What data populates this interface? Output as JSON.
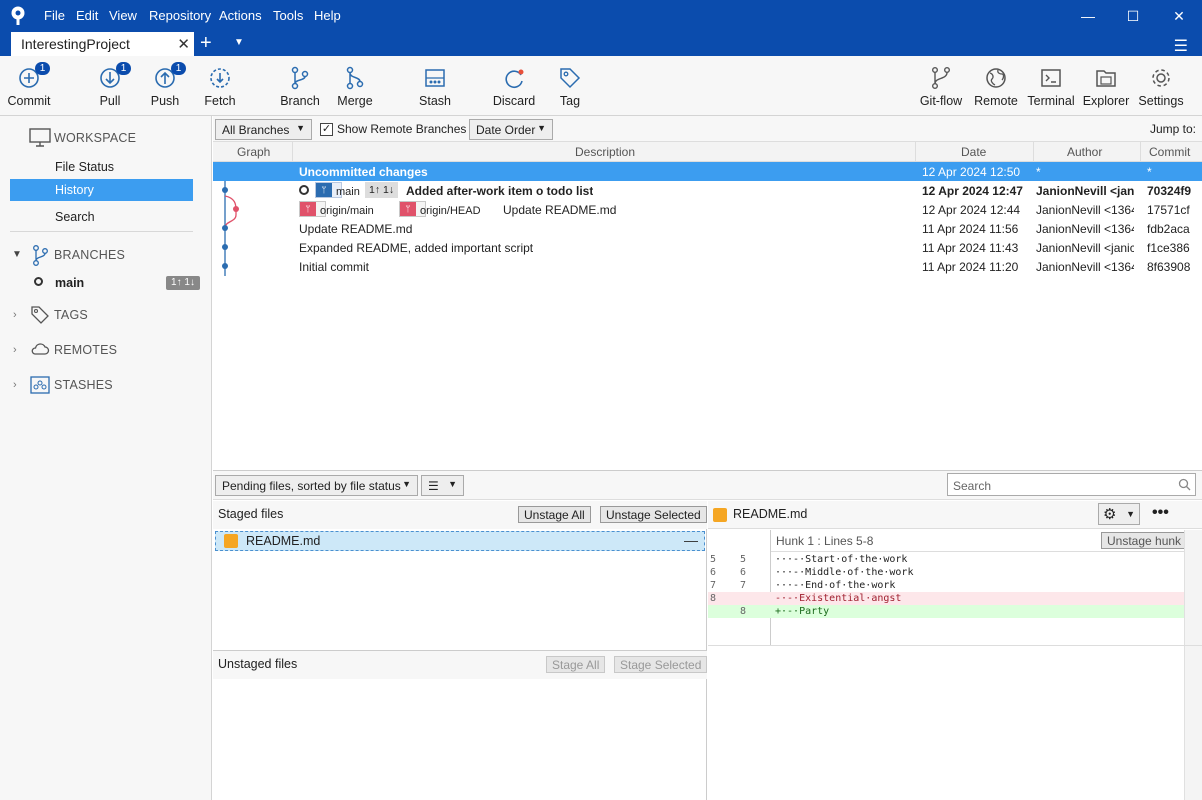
{
  "menu": [
    "File",
    "Edit",
    "View",
    "Repository",
    "Actions",
    "Tools",
    "Help"
  ],
  "tab": {
    "title": "InterestingProject"
  },
  "toolbar": {
    "commit": {
      "label": "Commit",
      "badge": "1"
    },
    "pull": {
      "label": "Pull",
      "badge": "1"
    },
    "push": {
      "label": "Push",
      "badge": "1"
    },
    "fetch": {
      "label": "Fetch"
    },
    "branch": {
      "label": "Branch"
    },
    "merge": {
      "label": "Merge"
    },
    "stash": {
      "label": "Stash"
    },
    "discard": {
      "label": "Discard"
    },
    "tag": {
      "label": "Tag"
    },
    "gitflow": {
      "label": "Git-flow"
    },
    "remote": {
      "label": "Remote"
    },
    "terminal": {
      "label": "Terminal"
    },
    "explorer": {
      "label": "Explorer"
    },
    "settings": {
      "label": "Settings"
    }
  },
  "sidebar": {
    "workspace": "WORKSPACE",
    "file_status": "File Status",
    "history": "History",
    "search": "Search",
    "branches": "BRANCHES",
    "main_branch": "main",
    "main_ahead": "1↑ 1↓",
    "tags": "TAGS",
    "remotes": "REMOTES",
    "stashes": "STASHES"
  },
  "filter": {
    "all_branches": "All Branches",
    "show_remote": "Show Remote Branches",
    "date_order": "Date Order",
    "jump_to": "Jump to:"
  },
  "columns": {
    "graph": "Graph",
    "description": "Description",
    "date": "Date",
    "author": "Author",
    "commit": "Commit"
  },
  "commits": [
    {
      "description": "Uncommitted changes",
      "date": "12 Apr 2024 12:50",
      "author": "*",
      "commit": "*"
    },
    {
      "branch": "main",
      "ahead": "1↑ 1↓",
      "description": "Added after-work item o todo list",
      "date": "12 Apr 2024 12:47",
      "author": "JanionNevill <jani",
      "commit": "70324f9"
    },
    {
      "ref1": "origin/main",
      "ref2": "origin/HEAD",
      "description": "Update README.md",
      "date": "12 Apr 2024 12:44",
      "author": "JanionNevill <1364",
      "commit": "17571cf"
    },
    {
      "description": "Update README.md",
      "date": "11 Apr 2024 11:56",
      "author": "JanionNevill <1364",
      "commit": "fdb2aca"
    },
    {
      "description": "Expanded README, added important script",
      "date": "11 Apr 2024 11:43",
      "author": "JanionNevill <janic",
      "commit": "f1ce386"
    },
    {
      "description": "Initial commit",
      "date": "11 Apr 2024 11:20",
      "author": "JanionNevill <1364",
      "commit": "8f63908"
    }
  ],
  "bottom": {
    "pending": "Pending files, sorted by file status",
    "search_placeholder": "Search"
  },
  "staged": {
    "title": "Staged files",
    "unstage_all": "Unstage All",
    "unstage_selected": "Unstage Selected",
    "file": "README.md"
  },
  "unstaged": {
    "title": "Unstaged files",
    "stage_all": "Stage All",
    "stage_selected": "Stage Selected"
  },
  "diff": {
    "file": "README.md",
    "hunk": "Hunk 1 : Lines 5-8",
    "unstage_hunk": "Unstage hunk",
    "lines": [
      {
        "old": "5",
        "new": "5",
        "text": "···-·Start·of·the·work",
        "kind": "ctx"
      },
      {
        "old": "6",
        "new": "6",
        "text": "···-·Middle·of·the·work",
        "kind": "ctx"
      },
      {
        "old": "7",
        "new": "7",
        "text": "···-·End·of·the·work",
        "kind": "ctx"
      },
      {
        "old": "8",
        "new": "",
        "text": "-·-·Existential·angst",
        "kind": "del"
      },
      {
        "old": "",
        "new": "8",
        "text": "+·-·Party",
        "kind": "add"
      }
    ]
  },
  "colors": {
    "accent": "#0b4cad",
    "selection": "#3c9df0",
    "remote_ref": "#e0526a",
    "branch_ref": "#2b6cb0"
  }
}
